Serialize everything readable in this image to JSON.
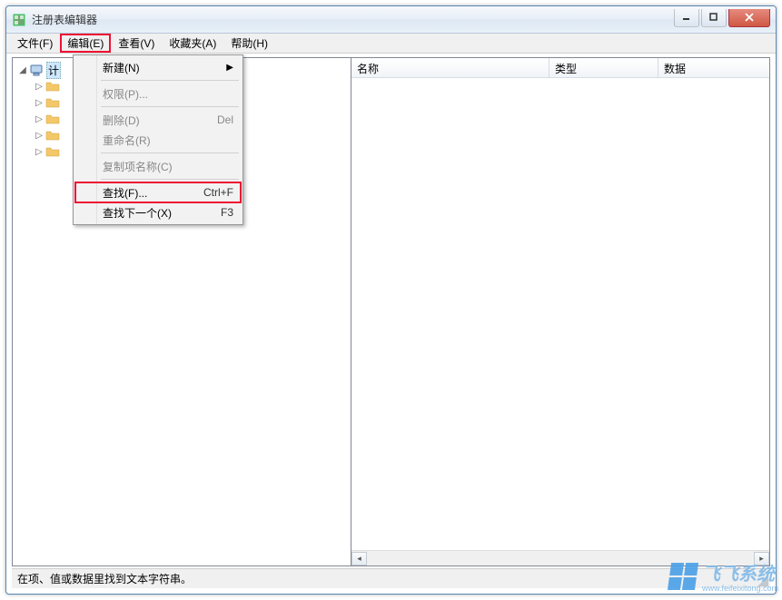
{
  "window": {
    "title": "注册表编辑器"
  },
  "menubar": {
    "file": "文件(F)",
    "edit": "编辑(E)",
    "view": "查看(V)",
    "favorites": "收藏夹(A)",
    "help": "帮助(H)"
  },
  "edit_menu": {
    "new": "新建(N)",
    "permissions": "权限(P)...",
    "delete": {
      "label": "删除(D)",
      "shortcut": "Del"
    },
    "rename": "重命名(R)",
    "copy_key_name": "复制项名称(C)",
    "find": {
      "label": "查找(F)...",
      "shortcut": "Ctrl+F"
    },
    "find_next": {
      "label": "查找下一个(X)",
      "shortcut": "F3"
    }
  },
  "tree": {
    "root_partial": "计"
  },
  "list": {
    "columns": {
      "name": "名称",
      "type": "类型",
      "data": "数据"
    }
  },
  "statusbar": {
    "text": "在项、值或数据里找到文本字符串。"
  },
  "watermark": {
    "brand": "飞飞系统",
    "url": "www.feifeixitong.com"
  }
}
